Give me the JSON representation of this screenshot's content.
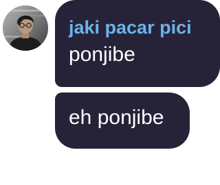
{
  "sender": {
    "name": "jaki pacar pici",
    "name_color": "#6cb2ec",
    "avatar": "profile-photo"
  },
  "messages": [
    {
      "text": "ponjibe"
    },
    {
      "text": "eh ponjibe"
    }
  ],
  "colors": {
    "bubble_background": "#262338",
    "message_text": "#ffffff",
    "page_background": "#ffffff"
  }
}
